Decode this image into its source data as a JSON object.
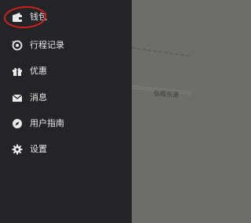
{
  "menu": {
    "items": [
      {
        "label": "钱包",
        "icon": "wallet-icon"
      },
      {
        "label": "行程记录",
        "icon": "trip-history-icon"
      },
      {
        "label": "优惠",
        "icon": "gift-icon"
      },
      {
        "label": "消息",
        "icon": "envelope-icon"
      },
      {
        "label": "用户指南",
        "icon": "compass-icon"
      },
      {
        "label": "设置",
        "icon": "gear-icon"
      }
    ]
  },
  "map": {
    "road_label": "弘程东道"
  },
  "annotation": {
    "highlight_color": "#d0201d"
  }
}
